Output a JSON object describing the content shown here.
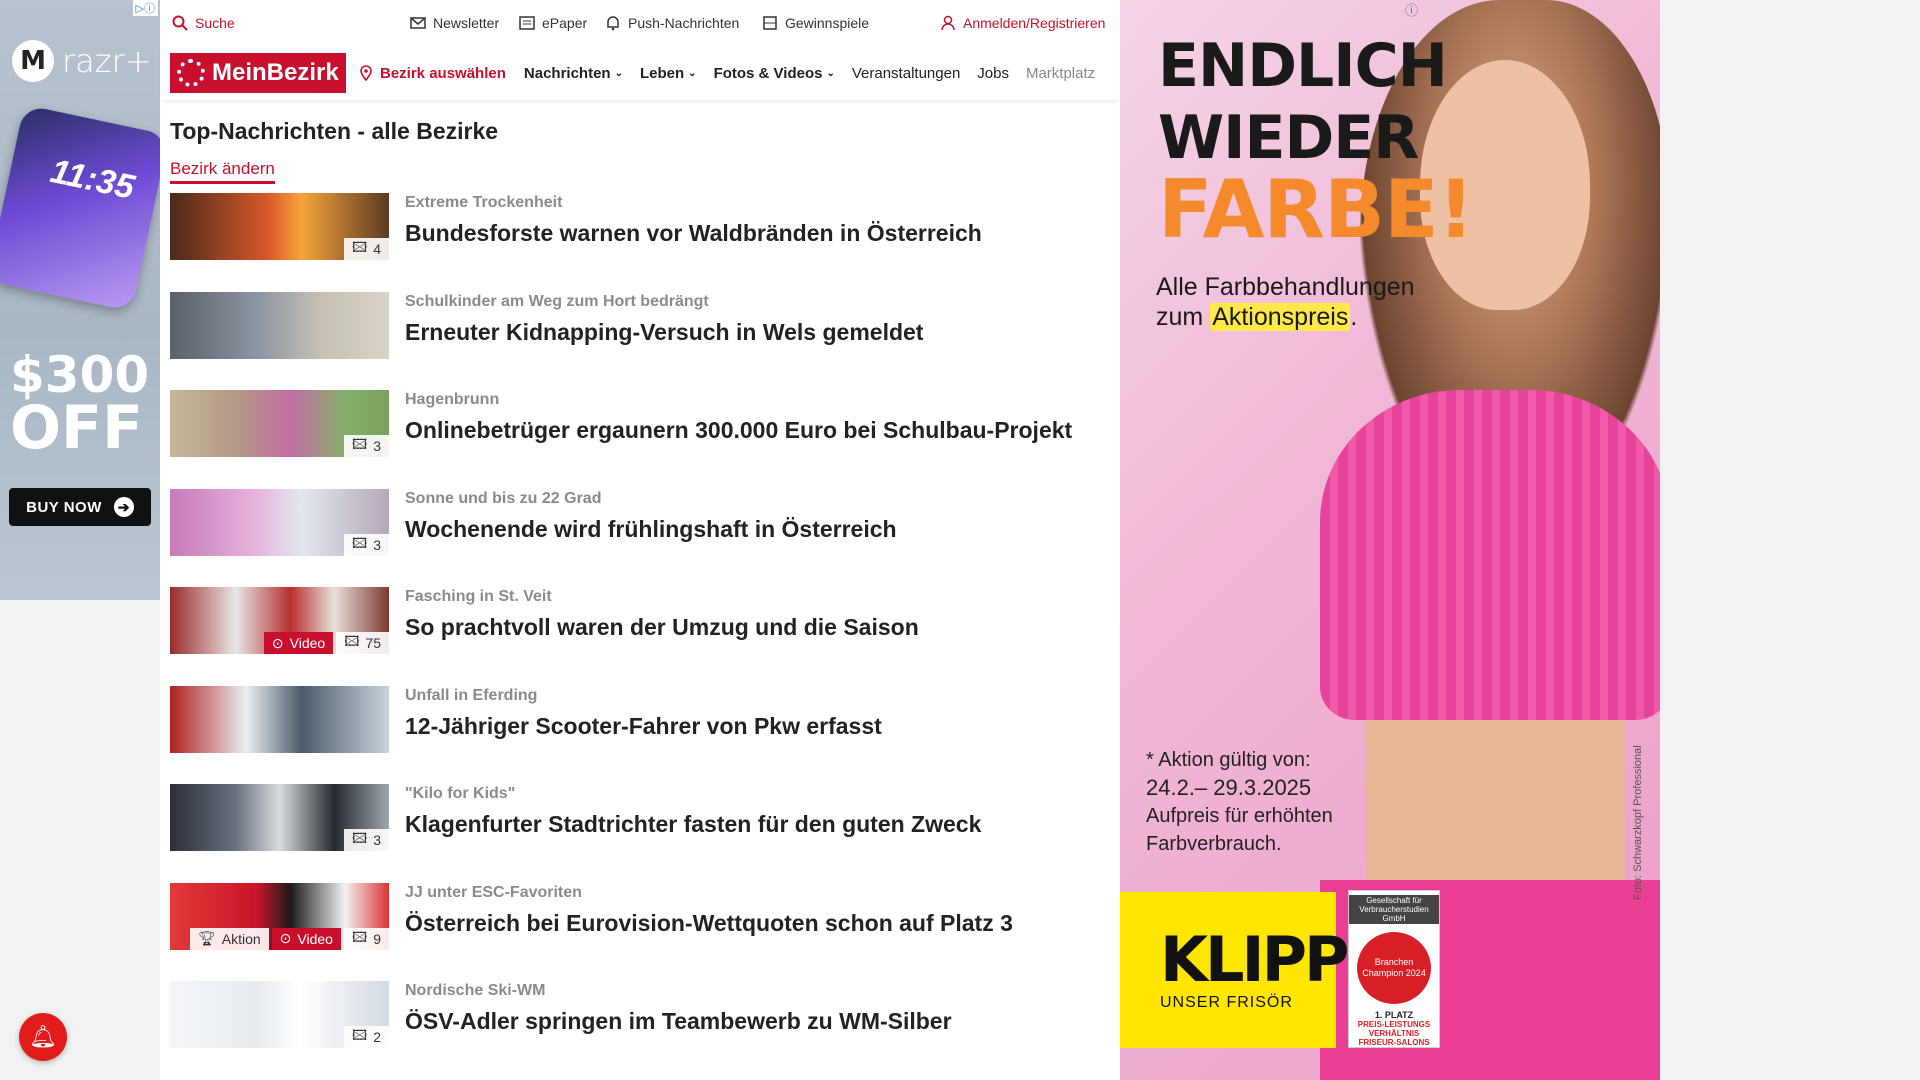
{
  "ad_left": {
    "badge": "▷ⓘ",
    "brand": "razr+",
    "phone_time": "11:35",
    "promo_amount": "$300",
    "promo_off": "OFF",
    "cta": "BUY NOW"
  },
  "topbar": {
    "search": "Suche",
    "newsletter": "Newsletter",
    "epaper": "ePaper",
    "push": "Push-Nachrichten",
    "gewinnspiele": "Gewinnspiele",
    "login": "Anmelden/Registrieren"
  },
  "nav": {
    "logo": "MeinBezirk",
    "bezirk": "Bezirk auswählen",
    "items": [
      "Nachrichten",
      "Leben",
      "Fotos & Videos",
      "Veranstaltungen",
      "Jobs",
      "Marktplatz"
    ]
  },
  "section": {
    "title": "Top-Nachrichten - alle Bezirke",
    "change": "Bezirk ändern"
  },
  "articles": [
    {
      "kicker": "Extreme Trockenheit",
      "headline": "Bundesforste warnen vor Waldbränden in Österreich",
      "photos": "4"
    },
    {
      "kicker": "Schulkinder am Weg zum Hort bedrängt",
      "headline": "Erneuter Kidnapping-Versuch in Wels gemeldet"
    },
    {
      "kicker": "Hagenbrunn",
      "headline": "Onlinebetrüger ergaunern 300.000 Euro bei Schulbau-Projekt",
      "photos": "3"
    },
    {
      "kicker": "Sonne und bis zu 22 Grad",
      "headline": "Wochenende wird frühlingshaft in Österreich",
      "photos": "3"
    },
    {
      "kicker": "Fasching in St. Veit",
      "headline": "So prachtvoll waren der Umzug und die Saison",
      "video": "Video",
      "photos": "75"
    },
    {
      "kicker": "Unfall in Eferding",
      "headline": "12-Jähriger Scooter-Fahrer von Pkw erfasst"
    },
    {
      "kicker": "\"Kilo for Kids\"",
      "headline": "Klagenfurter Stadtrichter fasten für den guten Zweck",
      "photos": "3"
    },
    {
      "kicker": "JJ unter ESC-Favoriten",
      "headline": "Österreich bei Eurovision-Wettquoten schon auf Platz 3",
      "aktion": "Aktion",
      "video": "Video",
      "photos": "9"
    },
    {
      "kicker": "Nordische Ski-WM",
      "headline": "ÖSV-Adler springen im Teambewerb zu WM-Silber",
      "photos": "2"
    }
  ],
  "ad_right": {
    "headline_1": "ENDLICH",
    "headline_2": "WIEDER",
    "headline_3": "FARBE!",
    "sub_1": "Alle Farbbehandlungen",
    "sub_2_prefix": "zum ",
    "sub_2_highlight": "Aktionspreis",
    "sub_2_suffix": ".",
    "terms_1": "* Aktion gültig von:",
    "terms_2": "24.2.– 29.3.2025",
    "terms_3": "Aufpreis für erhöhten",
    "terms_4": "Farbverbrauch.",
    "klipp": "KLIPP",
    "klipp_sub": "UNSER FRISÖR",
    "seal_header": "Gesellschaft für Verbraucherstudien GmbH",
    "seal_ring": "Branchen Champion 2024",
    "seal_place": "1. PLATZ",
    "seal_line": "PREIS-LEISTUNGS VERHÄLTNIS FRISEUR-SALONS",
    "photo_credit": "Foto: Schwarzkopf Professional"
  },
  "colors": {
    "accent": "#c8102e",
    "ad_pink": "#ec9dc8",
    "klipp_yellow": "#ffe600"
  }
}
